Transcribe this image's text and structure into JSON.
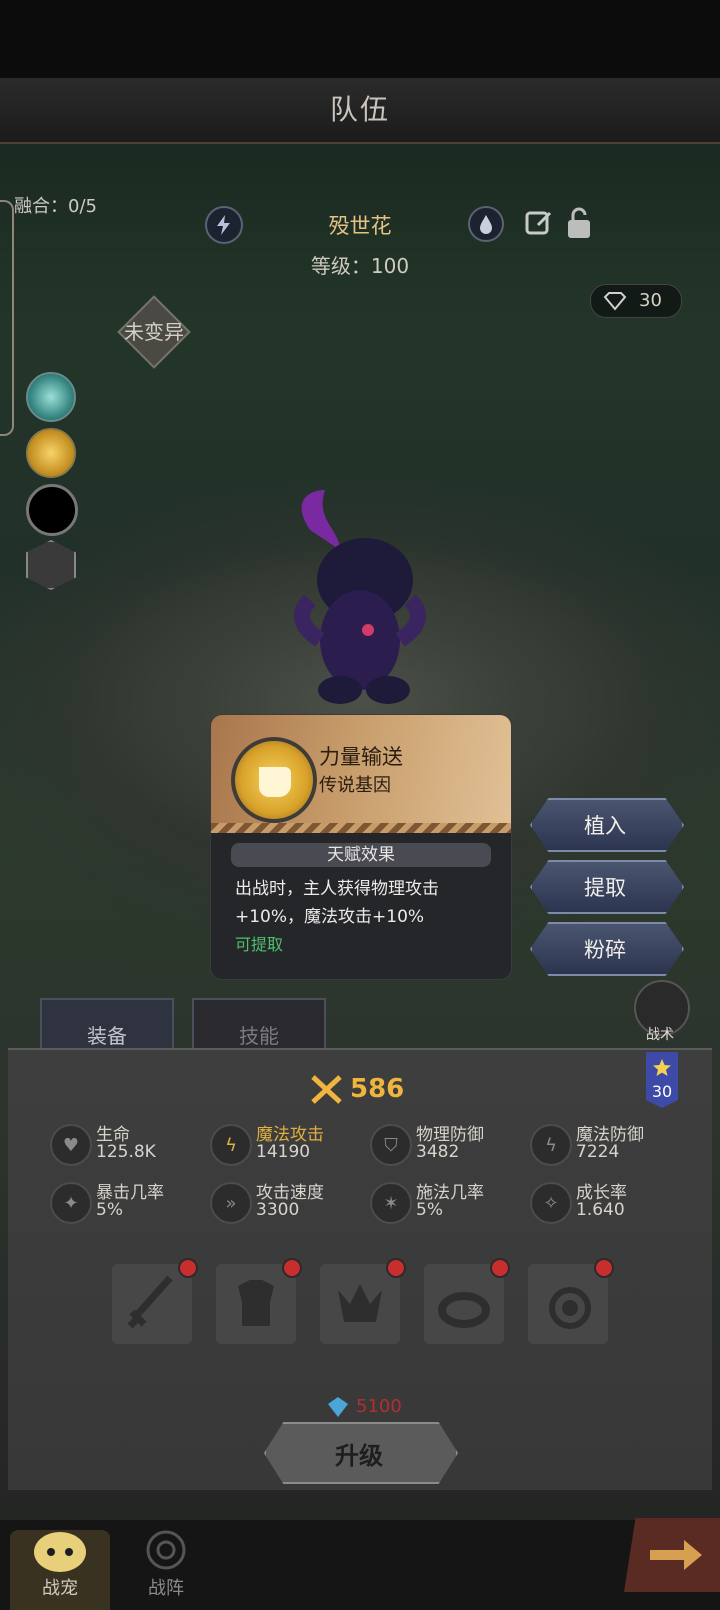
{
  "header": {
    "title": "队伍"
  },
  "fusion": {
    "label": "融合：0/5"
  },
  "pet": {
    "name": "殁世花",
    "level": "等级：100",
    "mutation": "未变异",
    "gems": "30"
  },
  "gene_popup": {
    "name": "力量输送",
    "rarity": "传说基因",
    "talent_title": "天赋效果",
    "talent_desc": "出战时，主人获得物理攻击+10%，魔法攻击+10%",
    "status": "可提取"
  },
  "actions": {
    "implant": "植入",
    "extract": "提取",
    "shatter": "粉碎"
  },
  "tabs": {
    "equipment": "装备",
    "skills": "技能"
  },
  "tactic": {
    "label": "战术"
  },
  "power": {
    "value": "586"
  },
  "star": {
    "value": "30"
  },
  "stats": [
    {
      "key": "生命",
      "value": "125.8K",
      "icon": "heart-icon"
    },
    {
      "key": "魔法攻击",
      "value": "14190",
      "icon": "lightning-icon"
    },
    {
      "key": "物理防御",
      "value": "3482",
      "icon": "shield-icon"
    },
    {
      "key": "魔法防御",
      "value": "7224",
      "icon": "magic-shield-icon"
    },
    {
      "key": "暴击几率",
      "value": "5%",
      "icon": "crit-icon"
    },
    {
      "key": "攻击速度",
      "value": "3300",
      "icon": "speed-icon"
    },
    {
      "key": "施法几率",
      "value": "5%",
      "icon": "cast-icon"
    },
    {
      "key": "成长率",
      "value": "1.640",
      "icon": "growth-icon"
    }
  ],
  "equip_slots": [
    "sword-icon",
    "armor-icon",
    "helmet-icon",
    "ring-icon",
    "amulet-icon"
  ],
  "upgrade": {
    "cost": "5100",
    "label": "升级"
  },
  "nav": {
    "pet": "战宠",
    "formation": "战阵"
  },
  "colors": {
    "accent_gold": "#f0b53d",
    "extract_green": "#4fc06a",
    "cost_red": "#b03030"
  }
}
